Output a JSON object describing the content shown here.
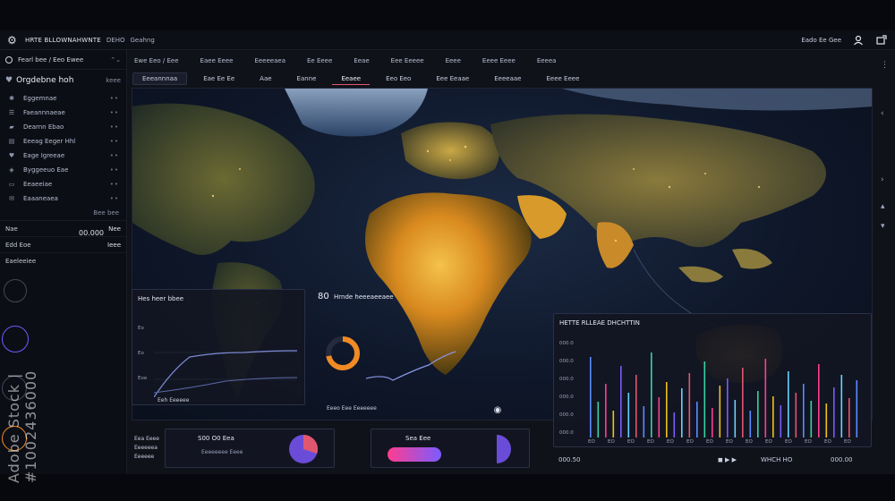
{
  "topbar": {
    "title": "HRTE BLLOWNAHWNTE",
    "sub": "DEHO",
    "sub2": "Geahng",
    "right_text": "Eado Ee Gee"
  },
  "sidebar": {
    "head": "Fearl bee / Eeo Ewee",
    "title": "Orgdebne hoh",
    "title_right": "keee",
    "items": [
      {
        "icon": "settings-icon",
        "label": "Eggemnae"
      },
      {
        "icon": "list-icon",
        "label": "Faeannnaeae"
      },
      {
        "icon": "folder-icon",
        "label": "Dearnn Ebao"
      },
      {
        "icon": "chart-icon",
        "label": "Eeeag Eeger Hhl"
      },
      {
        "icon": "heart-icon",
        "label": "Eage Igreeae"
      },
      {
        "icon": "tag-icon",
        "label": "Byggeeuo Eae"
      },
      {
        "icon": "card-icon",
        "label": "Eeaeeiae"
      },
      {
        "icon": "mail-icon",
        "label": "Eaaaneaea"
      }
    ],
    "foot": "Bee bee",
    "row1_left": "Nae",
    "row1_right": "Nee",
    "row2_left": "Edd Eoe",
    "row2_right": "Ieee",
    "row3_left": "Eaeleeiee",
    "number": "00.000"
  },
  "tabs": [
    "Ewe Eeo / Eee",
    "Eaee Eeee",
    "Eeeeeaea",
    "Ee Eeee",
    "Eeae",
    "Eee Eeeee",
    "Eeee",
    "Eeee Eeee",
    "Eeeea"
  ],
  "tabs2": [
    "Eeeannnaa",
    "Eae Ee Ee",
    "Aae",
    "Eanne",
    "Eeaee",
    "Eeo Eeo",
    "Eee Eeaae",
    "Eeeeaae",
    "Eeee Eeee"
  ],
  "line_panel": {
    "title": "Hes heer bbee",
    "ticks": [
      "Eo",
      "Eo",
      "Eoe"
    ],
    "footer": "Eeh Eeeeee"
  },
  "donut_panel": {
    "big": "80",
    "title": "Hrnde heeeaeeaee",
    "footer": "Eeeo Eee Eeeeeee",
    "percent": 72
  },
  "bars_panel": {
    "title": "HETTE RLLEAE DHCHTTIN",
    "yticks": [
      "000.0",
      "000.0",
      "000.0",
      "000.0",
      "000.0",
      "000.0"
    ],
    "xticks": [
      "EO",
      "EO",
      "EO",
      "EO",
      "EO",
      "EO",
      "EO",
      "EO",
      "EO",
      "EO",
      "EO",
      "EO",
      "EO",
      "EO"
    ],
    "footer_left": "000.50",
    "footer_right": "WHCH HO",
    "footer_far": "000.00"
  },
  "mini1": {
    "title": "S00 O0 Eea",
    "line": "Eeeeeeee Eeee",
    "percent": 30
  },
  "mini2": {
    "title": "Sea Eee",
    "percent": 50
  },
  "left_labels": [
    "Eea Eeee",
    "Eeeeeea",
    "Eeeeee"
  ],
  "watermark": "Adobe Stock | #1002436000",
  "colors": {
    "accent": "#e0566f",
    "orange": "#f08a24",
    "purple": "#7a5cff",
    "pink": "#ff3d8f",
    "blue": "#5a8cff"
  }
}
